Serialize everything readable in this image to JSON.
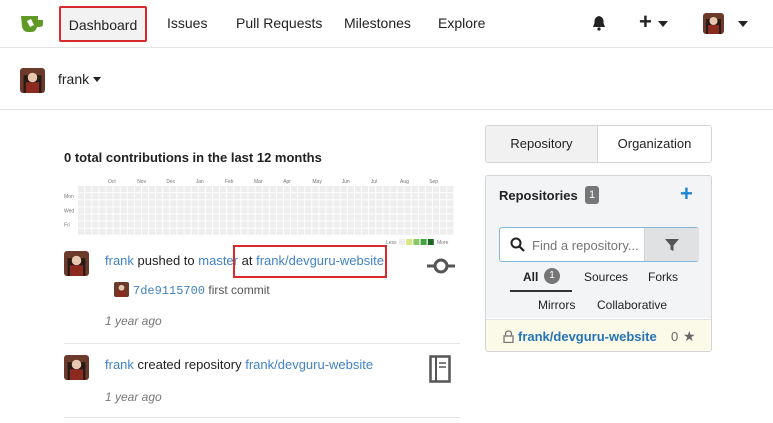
{
  "topnav": {
    "items": [
      {
        "label": "Dashboard"
      },
      {
        "label": "Issues"
      },
      {
        "label": "Pull Requests"
      },
      {
        "label": "Milestones"
      },
      {
        "label": "Explore"
      }
    ],
    "plus_label": "+",
    "icons": {
      "logo": "gitea-logo-icon",
      "bell": "bell-icon",
      "avatar": "user-avatar"
    }
  },
  "context": {
    "user": "frank"
  },
  "contributions": {
    "title": "0 total contributions in the last 12 months",
    "months": [
      "Oct",
      "Nov",
      "Dec",
      "Jan",
      "Feb",
      "Mar",
      "Apr",
      "May",
      "Jun",
      "Jul",
      "Aug",
      "Sep"
    ],
    "days": [
      "Mon",
      "Wed",
      "Fri"
    ],
    "legend_less": "Less",
    "legend_more": "More",
    "colors": {
      "empty": "#eeeeee",
      "l1": "#d6e685",
      "l2": "#8cc665",
      "l3": "#44a340",
      "l4": "#1e6823"
    }
  },
  "feed": [
    {
      "user": "frank",
      "action": "pushed to",
      "branch": "master",
      "at": "at",
      "repo": "frank/devguru-website",
      "commit_sha": "7de9115700",
      "commit_msg": "first commit",
      "time": "1 year ago",
      "icon": "push-commit-icon"
    },
    {
      "user": "frank",
      "action": "created repository",
      "repo": "frank/devguru-website",
      "time": "1 year ago",
      "icon": "book-icon"
    }
  ],
  "sidebar": {
    "tabs": [
      {
        "label": "Repository"
      },
      {
        "label": "Organization"
      }
    ],
    "repos_title": "Repositories",
    "repos_count": "1",
    "add_label": "+",
    "search_placeholder": "Find a repository...",
    "filters": {
      "all": "All",
      "all_count": "1",
      "sources": "Sources",
      "forks": "Forks",
      "mirrors": "Mirrors",
      "collaborative": "Collaborative"
    },
    "repo_list": [
      {
        "name": "frank/devguru-website",
        "stars": "0"
      }
    ]
  },
  "colors": {
    "accent": "#4183c4",
    "highlight_red": "#d9292d",
    "logo_green": "#609926"
  }
}
